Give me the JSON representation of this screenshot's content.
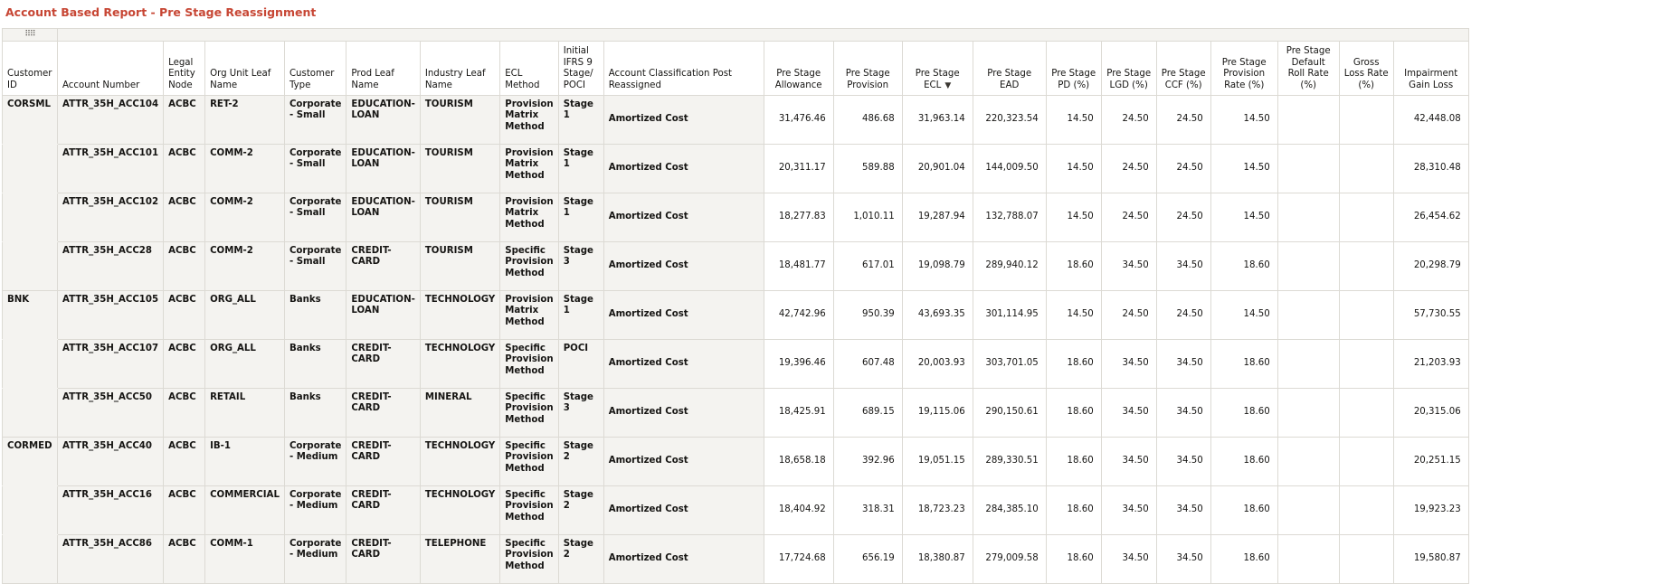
{
  "report": {
    "title": "Account Based Report - Pre Stage Reassignment"
  },
  "grid": {
    "handle_icon": "⠿⠿",
    "sort_icon": "▼",
    "columns": [
      {
        "label": "Customer ID"
      },
      {
        "label": "Account Number"
      },
      {
        "label": "Legal Entity Node"
      },
      {
        "label": "Org Unit Leaf Name"
      },
      {
        "label": "Customer Type"
      },
      {
        "label": "Prod Leaf Name"
      },
      {
        "label": "Industry Leaf Name"
      },
      {
        "label": "ECL Method"
      },
      {
        "label": "Initial IFRS 9 Stage/ POCI"
      },
      {
        "label": "Account Classification Post Reassigned"
      },
      {
        "label": "Pre Stage Allowance"
      },
      {
        "label": "Pre Stage Provision"
      },
      {
        "label": "Pre Stage ECL"
      },
      {
        "label": "Pre Stage EAD"
      },
      {
        "label": "Pre Stage PD (%)"
      },
      {
        "label": "Pre Stage LGD (%)"
      },
      {
        "label": "Pre Stage CCF (%)"
      },
      {
        "label": "Pre Stage Provision Rate (%)"
      },
      {
        "label": "Pre Stage Default Roll Rate (%)"
      },
      {
        "label": "Gross Loss Rate (%)"
      },
      {
        "label": "Impairment Gain Loss"
      }
    ],
    "rows": [
      {
        "customer_id": "CORSML",
        "account": "ATTR_35H_ACC104",
        "legal_entity": "ACBC",
        "org_unit": "RET-2",
        "cust_type": "Corporate - Small",
        "prod": "EDUCATION-LOAN",
        "industry": "TOURISM",
        "ecl_method": "Provision Matrix Method",
        "stage": "Stage 1",
        "classification": "Amortized Cost",
        "allowance": "31,476.46",
        "provision": "486.68",
        "ecl": "31,963.14",
        "ead": "220,323.54",
        "pd": "14.50",
        "lgd": "24.50",
        "ccf": "24.50",
        "prov_rate": "14.50",
        "roll_rate": "",
        "gross_loss": "",
        "impairment": "42,448.08"
      },
      {
        "customer_id": "",
        "account": "ATTR_35H_ACC101",
        "legal_entity": "ACBC",
        "org_unit": "COMM-2",
        "cust_type": "Corporate - Small",
        "prod": "EDUCATION-LOAN",
        "industry": "TOURISM",
        "ecl_method": "Provision Matrix Method",
        "stage": "Stage 1",
        "classification": "Amortized Cost",
        "allowance": "20,311.17",
        "provision": "589.88",
        "ecl": "20,901.04",
        "ead": "144,009.50",
        "pd": "14.50",
        "lgd": "24.50",
        "ccf": "24.50",
        "prov_rate": "14.50",
        "roll_rate": "",
        "gross_loss": "",
        "impairment": "28,310.48"
      },
      {
        "customer_id": "",
        "account": "ATTR_35H_ACC102",
        "legal_entity": "ACBC",
        "org_unit": "COMM-2",
        "cust_type": "Corporate - Small",
        "prod": "EDUCATION-LOAN",
        "industry": "TOURISM",
        "ecl_method": "Provision Matrix Method",
        "stage": "Stage 1",
        "classification": "Amortized Cost",
        "allowance": "18,277.83",
        "provision": "1,010.11",
        "ecl": "19,287.94",
        "ead": "132,788.07",
        "pd": "14.50",
        "lgd": "24.50",
        "ccf": "24.50",
        "prov_rate": "14.50",
        "roll_rate": "",
        "gross_loss": "",
        "impairment": "26,454.62"
      },
      {
        "customer_id": "",
        "account": "ATTR_35H_ACC28",
        "legal_entity": "ACBC",
        "org_unit": "COMM-2",
        "cust_type": "Corporate - Small",
        "prod": "CREDIT-CARD",
        "industry": "TOURISM",
        "ecl_method": "Specific Provision Method",
        "stage": "Stage 3",
        "classification": "Amortized Cost",
        "allowance": "18,481.77",
        "provision": "617.01",
        "ecl": "19,098.79",
        "ead": "289,940.12",
        "pd": "18.60",
        "lgd": "34.50",
        "ccf": "34.50",
        "prov_rate": "18.60",
        "roll_rate": "",
        "gross_loss": "",
        "impairment": "20,298.79"
      },
      {
        "customer_id": "BNK",
        "account": "ATTR_35H_ACC105",
        "legal_entity": "ACBC",
        "org_unit": "ORG_ALL",
        "cust_type": "Banks",
        "prod": "EDUCATION-LOAN",
        "industry": "TECHNOLOGY",
        "ecl_method": "Provision Matrix Method",
        "stage": "Stage 1",
        "classification": "Amortized Cost",
        "allowance": "42,742.96",
        "provision": "950.39",
        "ecl": "43,693.35",
        "ead": "301,114.95",
        "pd": "14.50",
        "lgd": "24.50",
        "ccf": "24.50",
        "prov_rate": "14.50",
        "roll_rate": "",
        "gross_loss": "",
        "impairment": "57,730.55"
      },
      {
        "customer_id": "",
        "account": "ATTR_35H_ACC107",
        "legal_entity": "ACBC",
        "org_unit": "ORG_ALL",
        "cust_type": "Banks",
        "prod": "CREDIT-CARD",
        "industry": "TECHNOLOGY",
        "ecl_method": "Specific Provision Method",
        "stage": "POCI",
        "classification": "Amortized Cost",
        "allowance": "19,396.46",
        "provision": "607.48",
        "ecl": "20,003.93",
        "ead": "303,701.05",
        "pd": "18.60",
        "lgd": "34.50",
        "ccf": "34.50",
        "prov_rate": "18.60",
        "roll_rate": "",
        "gross_loss": "",
        "impairment": "21,203.93"
      },
      {
        "customer_id": "",
        "account": "ATTR_35H_ACC50",
        "legal_entity": "ACBC",
        "org_unit": "RETAIL",
        "cust_type": "Banks",
        "prod": "CREDIT-CARD",
        "industry": "MINERAL",
        "ecl_method": "Specific Provision Method",
        "stage": "Stage 3",
        "classification": "Amortized Cost",
        "allowance": "18,425.91",
        "provision": "689.15",
        "ecl": "19,115.06",
        "ead": "290,150.61",
        "pd": "18.60",
        "lgd": "34.50",
        "ccf": "34.50",
        "prov_rate": "18.60",
        "roll_rate": "",
        "gross_loss": "",
        "impairment": "20,315.06"
      },
      {
        "customer_id": "CORMED",
        "account": "ATTR_35H_ACC40",
        "legal_entity": "ACBC",
        "org_unit": "IB-1",
        "cust_type": "Corporate - Medium",
        "prod": "CREDIT-CARD",
        "industry": "TECHNOLOGY",
        "ecl_method": "Specific Provision Method",
        "stage": "Stage 2",
        "classification": "Amortized Cost",
        "allowance": "18,658.18",
        "provision": "392.96",
        "ecl": "19,051.15",
        "ead": "289,330.51",
        "pd": "18.60",
        "lgd": "34.50",
        "ccf": "34.50",
        "prov_rate": "18.60",
        "roll_rate": "",
        "gross_loss": "",
        "impairment": "20,251.15"
      },
      {
        "customer_id": "",
        "account": "ATTR_35H_ACC16",
        "legal_entity": "ACBC",
        "org_unit": "COMMERCIAL",
        "cust_type": "Corporate - Medium",
        "prod": "CREDIT-CARD",
        "industry": "TECHNOLOGY",
        "ecl_method": "Specific Provision Method",
        "stage": "Stage 2",
        "classification": "Amortized Cost",
        "allowance": "18,404.92",
        "provision": "318.31",
        "ecl": "18,723.23",
        "ead": "284,385.10",
        "pd": "18.60",
        "lgd": "34.50",
        "ccf": "34.50",
        "prov_rate": "18.60",
        "roll_rate": "",
        "gross_loss": "",
        "impairment": "19,923.23"
      },
      {
        "customer_id": "",
        "account": "ATTR_35H_ACC86",
        "legal_entity": "ACBC",
        "org_unit": "COMM-1",
        "cust_type": "Corporate - Medium",
        "prod": "CREDIT-CARD",
        "industry": "TELEPHONE",
        "ecl_method": "Specific Provision Method",
        "stage": "Stage 2",
        "classification": "Amortized Cost",
        "allowance": "17,724.68",
        "provision": "656.19",
        "ecl": "18,380.87",
        "ead": "279,009.58",
        "pd": "18.60",
        "lgd": "34.50",
        "ccf": "34.50",
        "prov_rate": "18.60",
        "roll_rate": "",
        "gross_loss": "",
        "impairment": "19,580.87"
      }
    ]
  }
}
